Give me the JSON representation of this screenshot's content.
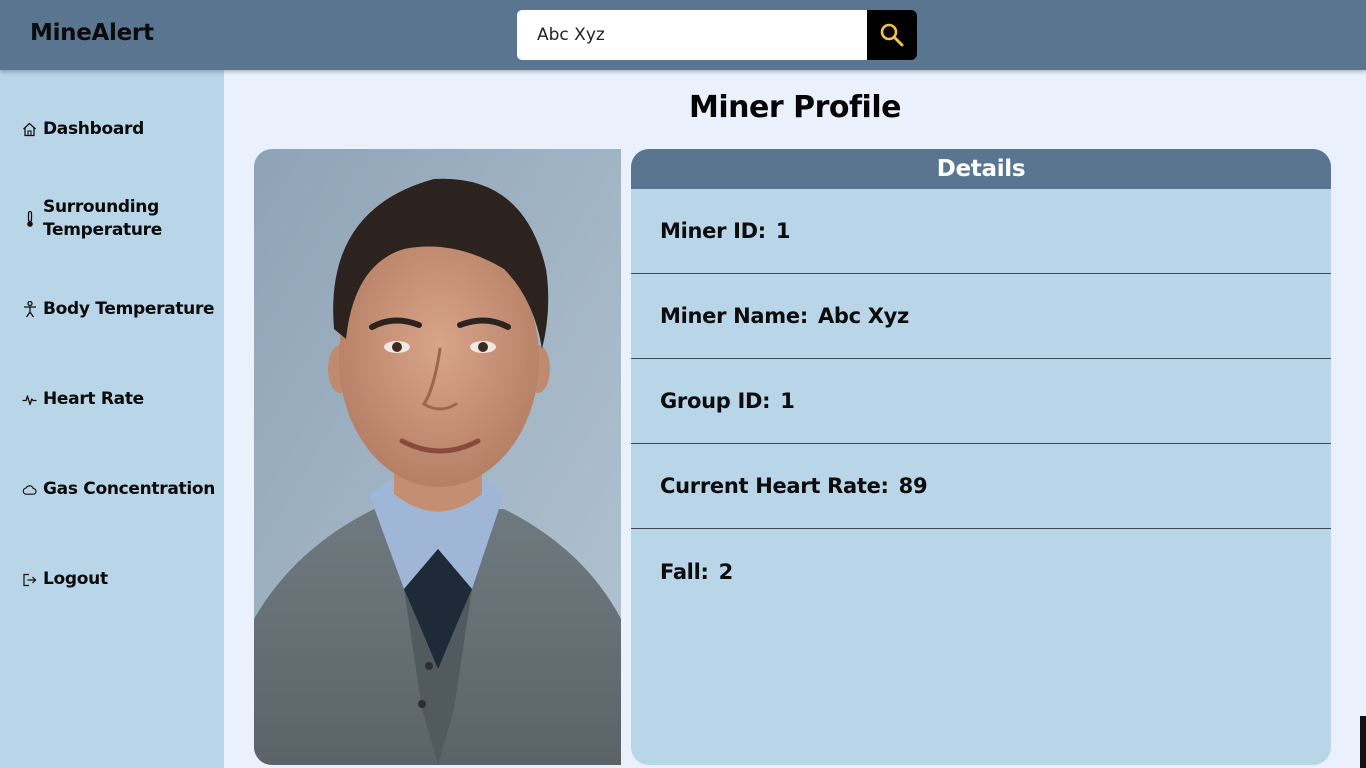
{
  "app": {
    "brand": "MineAlert"
  },
  "search": {
    "value": "Abc Xyz",
    "placeholder": ""
  },
  "sidebar": {
    "items": [
      {
        "label": "Dashboard",
        "icon": "home-icon"
      },
      {
        "label": "Surrounding Temperature",
        "icon": "thermometer-icon"
      },
      {
        "label": "Body Temperature",
        "icon": "body-icon"
      },
      {
        "label": "Heart Rate",
        "icon": "heartbeat-icon"
      },
      {
        "label": "Gas Concentration",
        "icon": "cloud-icon"
      },
      {
        "label": "Logout",
        "icon": "logout-icon"
      }
    ]
  },
  "page": {
    "title": "Miner Profile"
  },
  "details": {
    "heading": "Details",
    "rows": [
      {
        "label": "Miner ID:",
        "value": "1"
      },
      {
        "label": "Miner Name:",
        "value": "Abc Xyz"
      },
      {
        "label": "Group ID:",
        "value": "1"
      },
      {
        "label": "Current Heart Rate:",
        "value": "89"
      },
      {
        "label": "Fall:",
        "value": "2"
      }
    ]
  },
  "colors": {
    "topbar": "#5a7590",
    "sidebar": "#b9d5e8",
    "page_bg": "#eaf1fd",
    "search_icon": "#f2c14e"
  }
}
